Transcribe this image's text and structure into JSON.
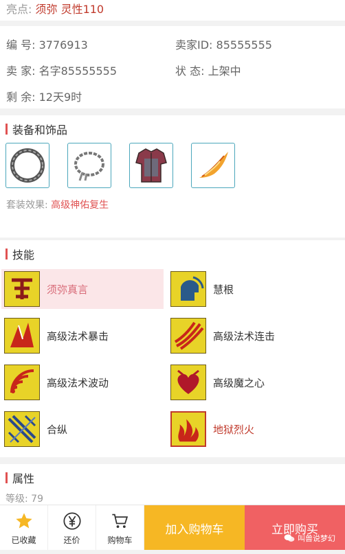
{
  "highlight": {
    "label": "亮点: ",
    "value": "须弥 灵性110"
  },
  "info": {
    "id_label": "编  号: ",
    "id_value": "3776913",
    "seller_id_label": "卖家ID: ",
    "seller_id_value": "85555555",
    "seller_label": "卖  家: ",
    "seller_value": "名字85555555",
    "status_label": "状  态: ",
    "status_value": "上架中",
    "remaining_label": "剩  余: ",
    "remaining_value": "12天9时"
  },
  "equipment": {
    "title": "装备和饰品",
    "items": [
      {
        "icon": "ring-icon"
      },
      {
        "icon": "chain-bracelet-icon"
      },
      {
        "icon": "armor-icon"
      },
      {
        "icon": "wing-icon"
      }
    ],
    "set_label": "套装效果: ",
    "set_value": "高级神佑复生"
  },
  "skills": {
    "title": "技能",
    "items": [
      {
        "name": "须弥真言",
        "icon": "sumeru-icon"
      },
      {
        "name": "慧根",
        "icon": "wisdom-icon"
      },
      {
        "name": "高级法术暴击",
        "icon": "spell-crit-icon"
      },
      {
        "name": "高级法术连击",
        "icon": "spell-combo-icon"
      },
      {
        "name": "高级法术波动",
        "icon": "spell-wave-icon"
      },
      {
        "name": "高级魔之心",
        "icon": "magic-heart-icon"
      },
      {
        "name": "合纵",
        "icon": "alliance-icon"
      },
      {
        "name": "地狱烈火",
        "icon": "hellfire-icon"
      }
    ]
  },
  "attributes": {
    "title": "属性",
    "partial_line": "等级: 79"
  },
  "bottom": {
    "favorited": "已收藏",
    "bargain": "还价",
    "cart": "购物车",
    "add_to_cart": "加入购物车",
    "buy_now": "立即购买",
    "watermark": "叫兽说梦幻"
  },
  "colors": {
    "accent_red": "#e05252",
    "cart_yellow": "#f6b724",
    "buy_red": "#f06163",
    "highlight_red": "#c0392b"
  }
}
